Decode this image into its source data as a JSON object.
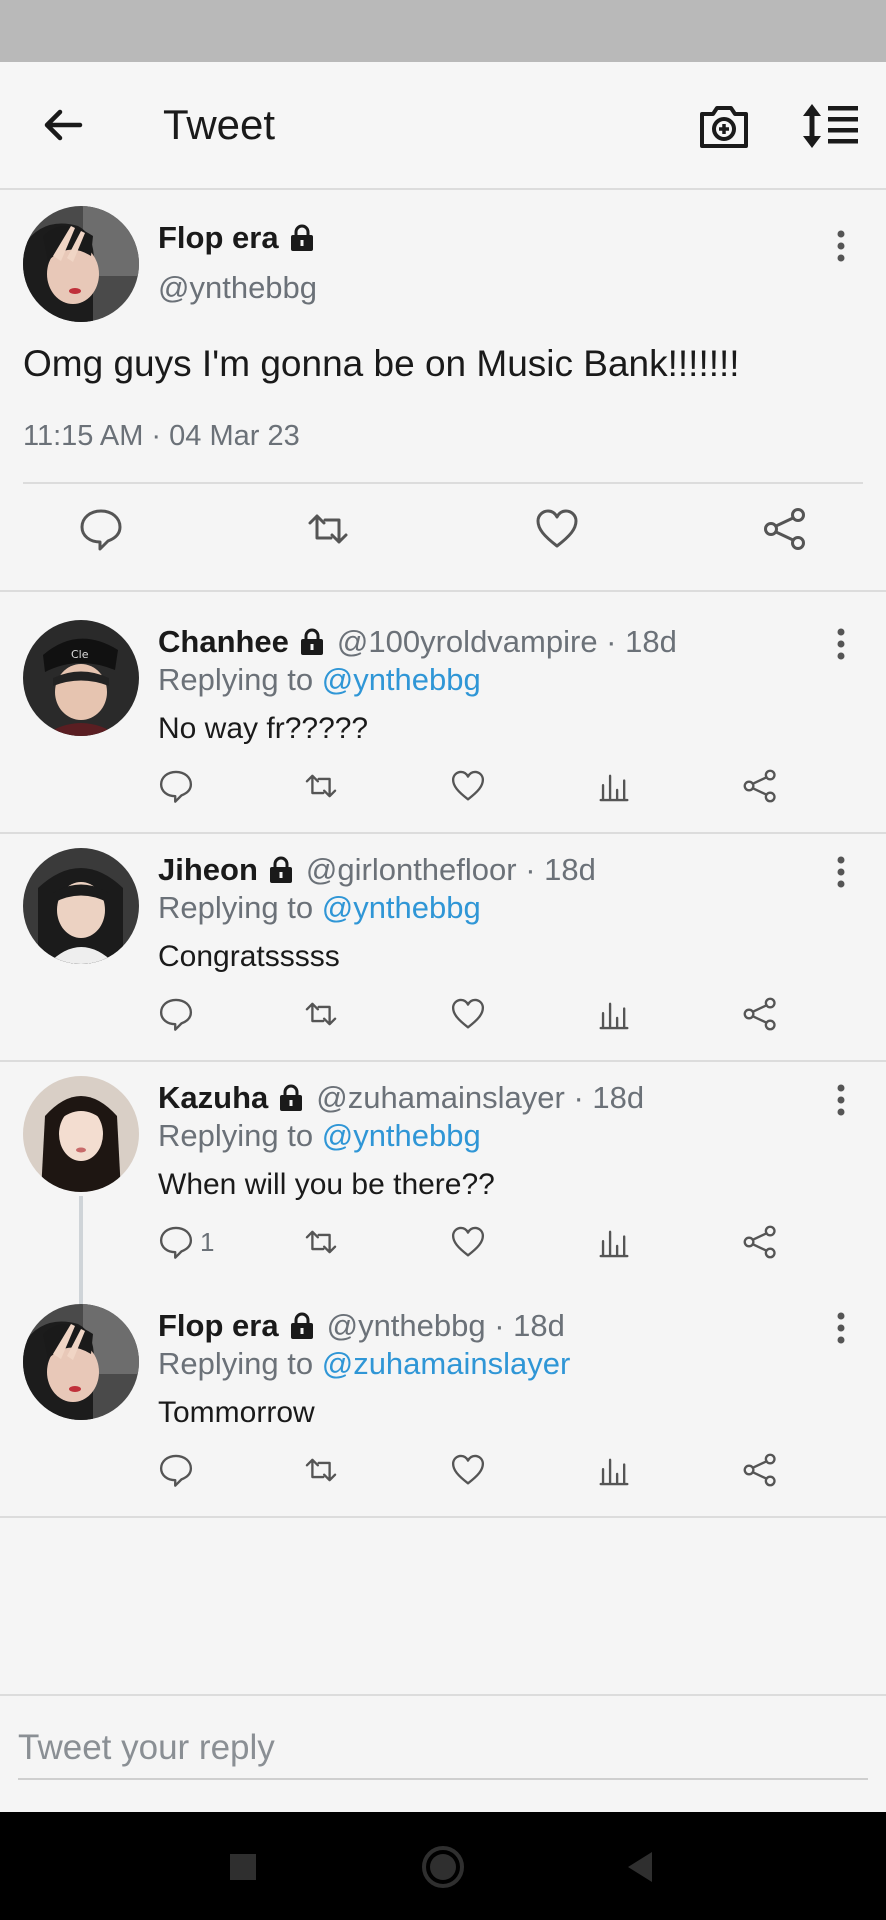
{
  "app_bar": {
    "title": "Tweet"
  },
  "main_tweet": {
    "display_name": "Flop era",
    "handle": "@ynthebbg",
    "text": "Omg guys I'm gonna be on Music Bank!!!!!!!",
    "timestamp": "11:15 AM · 04 Mar 23"
  },
  "replies": [
    {
      "display_name": "Chanhee",
      "meta": "@100yroldvampire · 18d",
      "replying_prefix": "Replying to ",
      "replying_to": "@ynthebbg",
      "text": "No way fr?????",
      "reply_count": ""
    },
    {
      "display_name": "Jiheon",
      "meta": "@girlonthefloor · 18d",
      "replying_prefix": "Replying to ",
      "replying_to": "@ynthebbg",
      "text": "Congratsssss",
      "reply_count": ""
    },
    {
      "display_name": "Kazuha",
      "meta": "@zuhamainslayer · 18d",
      "replying_prefix": "Replying to ",
      "replying_to": "@ynthebbg",
      "text": "When will you be there??",
      "reply_count": "1"
    },
    {
      "display_name": "Flop era",
      "meta": "@ynthebbg · 18d",
      "replying_prefix": "Replying to ",
      "replying_to": "@zuhamainslayer",
      "text": "Tommorrow",
      "reply_count": ""
    }
  ],
  "reply_bar": {
    "placeholder": "Tweet your reply"
  },
  "icons": {
    "back": "arrow-left-icon",
    "camera": "camera-add-icon",
    "sort": "sort-icon",
    "lock": "lock-icon",
    "more": "more-vertical-icon",
    "reply": "reply-icon",
    "retweet": "retweet-icon",
    "like": "heart-icon",
    "analytics": "analytics-icon",
    "share": "share-icon"
  },
  "colors": {
    "link": "#2f96d6",
    "secondary_text": "#6b7178",
    "status_bar": "#b9b9b9",
    "nav_bar": "#000000"
  }
}
